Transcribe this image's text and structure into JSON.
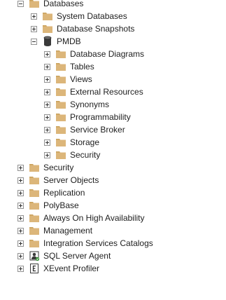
{
  "colors": {
    "folder_fill": "#DCB67A",
    "folder_tab": "#C9A15B",
    "toggle_border": "#919191",
    "text": "#1E1E1E"
  },
  "tree": {
    "databases": {
      "label": "Databases",
      "icon": "folder-icon",
      "children": {
        "system_databases": {
          "label": "System Databases",
          "icon": "folder-icon"
        },
        "database_snapshots": {
          "label": "Database Snapshots",
          "icon": "folder-icon"
        },
        "pmdb": {
          "label": "PMDB",
          "icon": "database-icon",
          "children": [
            {
              "label": "Database Diagrams",
              "icon": "folder-icon"
            },
            {
              "label": "Tables",
              "icon": "folder-icon"
            },
            {
              "label": "Views",
              "icon": "folder-icon"
            },
            {
              "label": "External Resources",
              "icon": "folder-icon"
            },
            {
              "label": "Synonyms",
              "icon": "folder-icon"
            },
            {
              "label": "Programmability",
              "icon": "folder-icon"
            },
            {
              "label": "Service Broker",
              "icon": "folder-icon"
            },
            {
              "label": "Storage",
              "icon": "folder-icon"
            },
            {
              "label": "Security",
              "icon": "folder-icon"
            }
          ]
        }
      }
    },
    "top_level": [
      {
        "label": "Security",
        "icon": "folder-icon"
      },
      {
        "label": "Server Objects",
        "icon": "folder-icon"
      },
      {
        "label": "Replication",
        "icon": "folder-icon"
      },
      {
        "label": "PolyBase",
        "icon": "folder-icon"
      },
      {
        "label": "Always On High Availability",
        "icon": "folder-icon"
      },
      {
        "label": "Management",
        "icon": "folder-icon"
      },
      {
        "label": "Integration Services Catalogs",
        "icon": "folder-icon"
      },
      {
        "label": "SQL Server Agent",
        "icon": "sql-agent-icon"
      },
      {
        "label": "XEvent Profiler",
        "icon": "xevent-profiler-icon"
      }
    ]
  }
}
